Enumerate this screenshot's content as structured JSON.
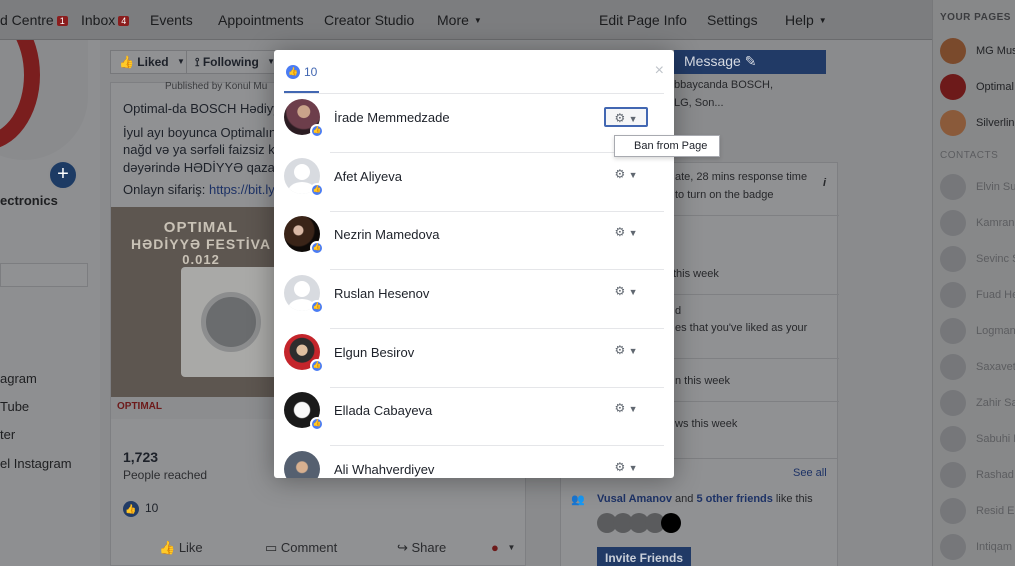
{
  "topnav": {
    "items": [
      {
        "label": "d Centre",
        "badge": "1"
      },
      {
        "label": "Inbox",
        "badge": "4"
      },
      {
        "label": "Events"
      },
      {
        "label": "Appointments"
      },
      {
        "label": "Creator Studio"
      },
      {
        "label": "More"
      },
      {
        "label": "Edit Page Info"
      },
      {
        "label": "Settings"
      },
      {
        "label": "Help"
      }
    ]
  },
  "left": {
    "category": "ectronics",
    "links": [
      "agram",
      "Tube",
      "ter",
      "el Instagram"
    ]
  },
  "post": {
    "liked_label": "Liked",
    "following_label": "Following",
    "published_by": "Published by Konul Mu",
    "lines": [
      "Optimal-da BOSCH Hədiyy",
      "İyul ayı boyunca Optimalın",
      "nağd və ya sərfəli faizsiz kr",
      "dəyərində HƏDİYYƏ qazan"
    ],
    "order_prefix": "Onlayn sifariş: ",
    "order_link": "https://bit.ly/",
    "image_title": "OPTIMAL",
    "image_subtitle": "HƏDİYYƏ FESTİVA",
    "image_price": "0.012",
    "image_tag": "OPTIMAL",
    "reach_count": "1,723",
    "reach_label": "People reached",
    "likes_count": "10",
    "actions": {
      "like": "Like",
      "comment": "Comment",
      "share": "Share"
    }
  },
  "right": {
    "message_label": "Message",
    "partial_right_lines": [
      "bbaycanda BOSCH,",
      "LG, Son..."
    ],
    "response_line": "ate, 28 mins response time",
    "badge_line": "to turn on the badge",
    "week_line1": "this week",
    "week_line2a": "d",
    "week_line2b": "es that you've liked as your",
    "week_line3": "n this week",
    "week_line4": "ws this week",
    "see_all": "See all",
    "friends_name": "Vusal Amanov",
    "friends_and": " and ",
    "friends_others": "5 other friends",
    "friends_suffix": " like this",
    "invite_label": "Invite Friends"
  },
  "sidebar": {
    "your_pages_heading": "YOUR PAGES",
    "pages": [
      "MG Mus",
      "Optimal",
      "Silverline"
    ],
    "contacts_heading": "CONTACTS",
    "contacts": [
      "Elvin Su",
      "Kamran",
      "Sevinc S",
      "Fuad He",
      "Logman",
      "Saxavet",
      "Zahir Sa",
      "Sabuhi H",
      "Rashad",
      "Resid El",
      "Intiqam"
    ]
  },
  "modal": {
    "tab_count": "10",
    "close_symbol": "×",
    "people": [
      {
        "name": "İrade Memmedzade"
      },
      {
        "name": "Afet Aliyeva"
      },
      {
        "name": "Nezrin Mamedova"
      },
      {
        "name": "Ruslan Hesenov"
      },
      {
        "name": "Elgun Besirov"
      },
      {
        "name": "Ellada Cabayeva"
      },
      {
        "name": "Ali Whahverdiyev"
      }
    ],
    "dropdown_item": "Ban from Page"
  },
  "icons": {
    "like": "thumbs-up-icon",
    "gear": "gear-icon",
    "caret": "caret-down-icon",
    "close": "close-icon",
    "plus": "plus-icon",
    "pencil": "pencil-icon"
  },
  "colors": {
    "accent": "#4267b2",
    "like_blue": "#4a7cf4",
    "overlay_bg": "#8a8b8d"
  }
}
